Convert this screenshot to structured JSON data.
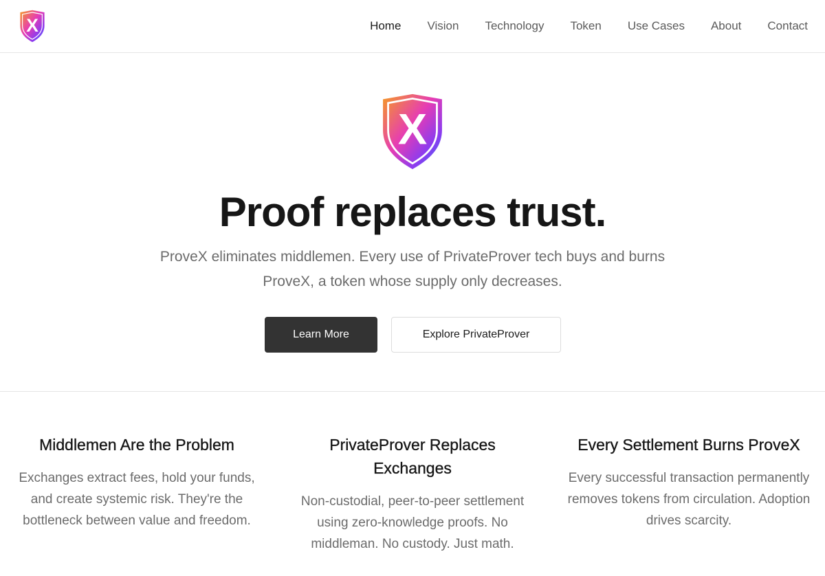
{
  "brand": {
    "logo_icon": "provex-shield-x-logo",
    "logo_letter": "X",
    "gradient_colors": [
      "#f59a23",
      "#e63cb4",
      "#8a3cf0",
      "#3d6cf5"
    ]
  },
  "nav": {
    "items": [
      {
        "label": "Home",
        "active": true
      },
      {
        "label": "Vision",
        "active": false
      },
      {
        "label": "Technology",
        "active": false
      },
      {
        "label": "Token",
        "active": false
      },
      {
        "label": "Use Cases",
        "active": false
      },
      {
        "label": "About",
        "active": false
      },
      {
        "label": "Contact",
        "active": false
      }
    ]
  },
  "hero": {
    "title": "Proof replaces trust.",
    "subtitle": "ProveX eliminates middlemen. Every use of PrivateProver tech buys and burns ProveX, a token whose supply only decreases.",
    "primary_button": "Learn More",
    "secondary_button": "Explore PrivateProver"
  },
  "features": [
    {
      "title": "Middlemen Are the Problem",
      "body": "Exchanges extract fees, hold your funds, and create systemic risk. They're the bottleneck between value and freedom."
    },
    {
      "title": "PrivateProver Replaces Exchanges",
      "body": "Non-custodial, peer-to-peer settlement using zero-knowledge proofs. No middleman. No custody. Just math."
    },
    {
      "title": "Every Settlement Burns ProveX",
      "body": "Every successful transaction permanently removes tokens from circulation. Adoption drives scarcity."
    }
  ],
  "colors": {
    "primary_button_bg": "#333333",
    "text_dark": "#161616",
    "text_muted": "#6b6b6b",
    "divider": "#e5e5e5"
  }
}
